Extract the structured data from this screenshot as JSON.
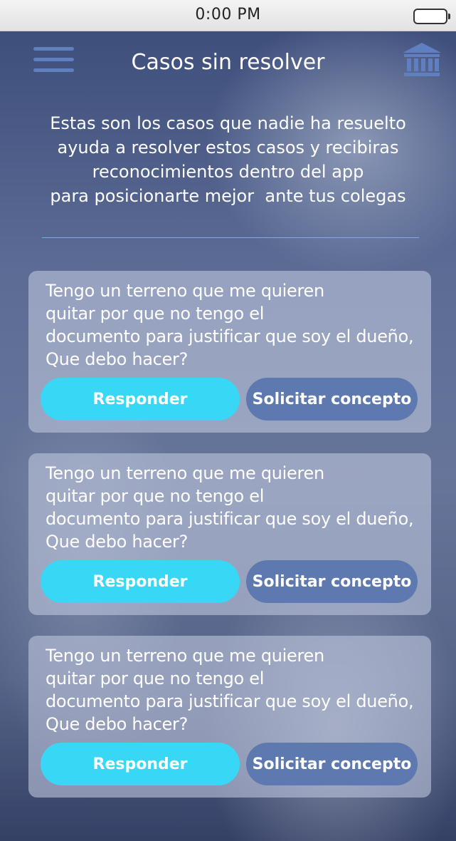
{
  "status_bar": {
    "time": "0:00 PM"
  },
  "header": {
    "title": "Casos sin resolver",
    "menu_icon": "hamburger-menu-icon",
    "court_icon": "courthouse-icon"
  },
  "intro": {
    "lines": [
      "Estas son los casos que nadie ha resuelto",
      "ayuda a resolver estos casos y recibiras",
      "reconocimientos dentro del app",
      "para posicionarte mejor  ante tus colegas"
    ]
  },
  "colors": {
    "accent": "#37d7f5",
    "secondary_button": "#5d79b0",
    "divider": "#4fc3ea"
  },
  "cases": [
    {
      "lines": [
        "Tengo un terreno que me quieren",
        "quitar por que no tengo el",
        "documento para justificar que soy el dueño,",
        "Que debo hacer?"
      ],
      "respond_label": "Responder",
      "concept_label": "Solicitar concepto"
    },
    {
      "lines": [
        "Tengo un terreno que me quieren",
        "quitar por que no tengo el",
        "documento para justificar que soy el dueño,",
        "Que debo hacer?"
      ],
      "respond_label": "Responder",
      "concept_label": "Solicitar concepto"
    },
    {
      "lines": [
        "Tengo un terreno que me quieren",
        "quitar por que no tengo el",
        "documento para justificar que soy el dueño,",
        "Que debo hacer?"
      ],
      "respond_label": "Responder",
      "concept_label": "Solicitar concepto"
    }
  ]
}
